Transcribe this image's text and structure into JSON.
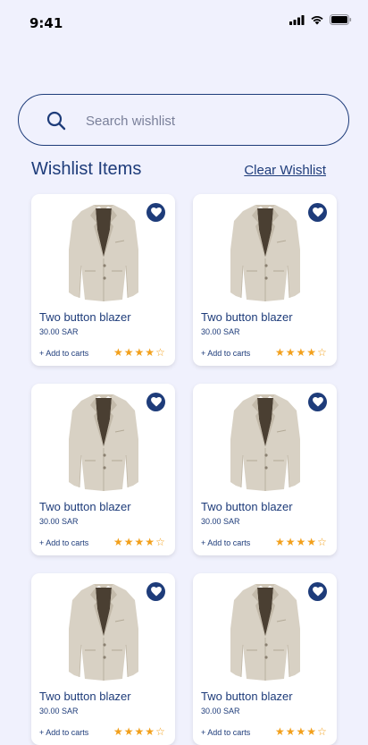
{
  "status_bar": {
    "time": "9:41"
  },
  "search": {
    "placeholder": "Search wishlist",
    "value": ""
  },
  "section": {
    "title": "Wishlist Items",
    "clear_label": "Clear Wishlist"
  },
  "colors": {
    "accent": "#1e3c7a",
    "star": "#f2a01c",
    "background": "#f0f1fd"
  },
  "items": [
    {
      "name": "Two button blazer",
      "price": "30.00 SAR",
      "add_label": "+ Add to carts",
      "rating": 4,
      "rating_max": 5,
      "icon": "blazer-image",
      "favorite": true
    },
    {
      "name": "Two button blazer",
      "price": "30.00 SAR",
      "add_label": "+ Add to carts",
      "rating": 4,
      "rating_max": 5,
      "icon": "blazer-image",
      "favorite": true
    },
    {
      "name": "Two button blazer",
      "price": "30.00 SAR",
      "add_label": "+ Add to carts",
      "rating": 4,
      "rating_max": 5,
      "icon": "blazer-image",
      "favorite": true
    },
    {
      "name": "Two button blazer",
      "price": "30.00 SAR",
      "add_label": "+ Add to carts",
      "rating": 4,
      "rating_max": 5,
      "icon": "blazer-image",
      "favorite": true
    },
    {
      "name": "Two button blazer",
      "price": "30.00 SAR",
      "add_label": "+ Add to carts",
      "rating": 4,
      "rating_max": 5,
      "icon": "blazer-image",
      "favorite": true
    },
    {
      "name": "Two button blazer",
      "price": "30.00 SAR",
      "add_label": "+ Add to carts",
      "rating": 4,
      "rating_max": 5,
      "icon": "blazer-image",
      "favorite": true
    }
  ]
}
